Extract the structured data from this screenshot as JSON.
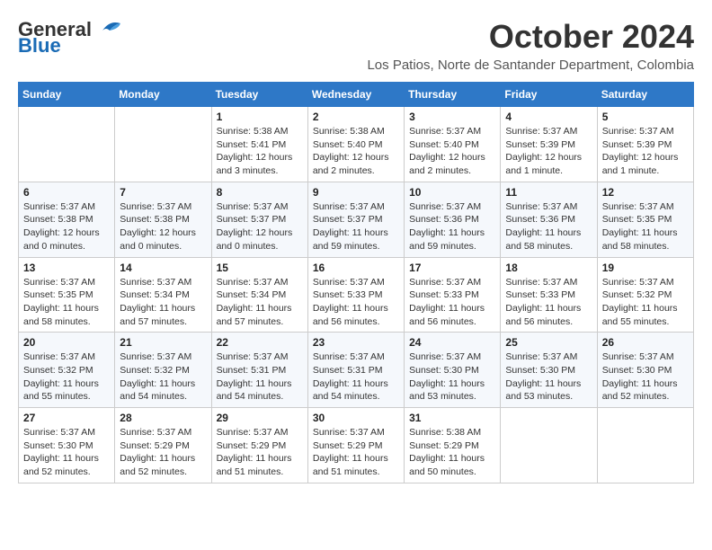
{
  "logo": {
    "general": "General",
    "blue": "Blue"
  },
  "title": "October 2024",
  "location": "Los Patios, Norte de Santander Department, Colombia",
  "weekdays": [
    "Sunday",
    "Monday",
    "Tuesday",
    "Wednesday",
    "Thursday",
    "Friday",
    "Saturday"
  ],
  "weeks": [
    [
      {
        "day": "",
        "info": ""
      },
      {
        "day": "",
        "info": ""
      },
      {
        "day": "1",
        "info": "Sunrise: 5:38 AM\nSunset: 5:41 PM\nDaylight: 12 hours and 3 minutes."
      },
      {
        "day": "2",
        "info": "Sunrise: 5:38 AM\nSunset: 5:40 PM\nDaylight: 12 hours and 2 minutes."
      },
      {
        "day": "3",
        "info": "Sunrise: 5:37 AM\nSunset: 5:40 PM\nDaylight: 12 hours and 2 minutes."
      },
      {
        "day": "4",
        "info": "Sunrise: 5:37 AM\nSunset: 5:39 PM\nDaylight: 12 hours and 1 minute."
      },
      {
        "day": "5",
        "info": "Sunrise: 5:37 AM\nSunset: 5:39 PM\nDaylight: 12 hours and 1 minute."
      }
    ],
    [
      {
        "day": "6",
        "info": "Sunrise: 5:37 AM\nSunset: 5:38 PM\nDaylight: 12 hours and 0 minutes."
      },
      {
        "day": "7",
        "info": "Sunrise: 5:37 AM\nSunset: 5:38 PM\nDaylight: 12 hours and 0 minutes."
      },
      {
        "day": "8",
        "info": "Sunrise: 5:37 AM\nSunset: 5:37 PM\nDaylight: 12 hours and 0 minutes."
      },
      {
        "day": "9",
        "info": "Sunrise: 5:37 AM\nSunset: 5:37 PM\nDaylight: 11 hours and 59 minutes."
      },
      {
        "day": "10",
        "info": "Sunrise: 5:37 AM\nSunset: 5:36 PM\nDaylight: 11 hours and 59 minutes."
      },
      {
        "day": "11",
        "info": "Sunrise: 5:37 AM\nSunset: 5:36 PM\nDaylight: 11 hours and 58 minutes."
      },
      {
        "day": "12",
        "info": "Sunrise: 5:37 AM\nSunset: 5:35 PM\nDaylight: 11 hours and 58 minutes."
      }
    ],
    [
      {
        "day": "13",
        "info": "Sunrise: 5:37 AM\nSunset: 5:35 PM\nDaylight: 11 hours and 58 minutes."
      },
      {
        "day": "14",
        "info": "Sunrise: 5:37 AM\nSunset: 5:34 PM\nDaylight: 11 hours and 57 minutes."
      },
      {
        "day": "15",
        "info": "Sunrise: 5:37 AM\nSunset: 5:34 PM\nDaylight: 11 hours and 57 minutes."
      },
      {
        "day": "16",
        "info": "Sunrise: 5:37 AM\nSunset: 5:33 PM\nDaylight: 11 hours and 56 minutes."
      },
      {
        "day": "17",
        "info": "Sunrise: 5:37 AM\nSunset: 5:33 PM\nDaylight: 11 hours and 56 minutes."
      },
      {
        "day": "18",
        "info": "Sunrise: 5:37 AM\nSunset: 5:33 PM\nDaylight: 11 hours and 56 minutes."
      },
      {
        "day": "19",
        "info": "Sunrise: 5:37 AM\nSunset: 5:32 PM\nDaylight: 11 hours and 55 minutes."
      }
    ],
    [
      {
        "day": "20",
        "info": "Sunrise: 5:37 AM\nSunset: 5:32 PM\nDaylight: 11 hours and 55 minutes."
      },
      {
        "day": "21",
        "info": "Sunrise: 5:37 AM\nSunset: 5:32 PM\nDaylight: 11 hours and 54 minutes."
      },
      {
        "day": "22",
        "info": "Sunrise: 5:37 AM\nSunset: 5:31 PM\nDaylight: 11 hours and 54 minutes."
      },
      {
        "day": "23",
        "info": "Sunrise: 5:37 AM\nSunset: 5:31 PM\nDaylight: 11 hours and 54 minutes."
      },
      {
        "day": "24",
        "info": "Sunrise: 5:37 AM\nSunset: 5:30 PM\nDaylight: 11 hours and 53 minutes."
      },
      {
        "day": "25",
        "info": "Sunrise: 5:37 AM\nSunset: 5:30 PM\nDaylight: 11 hours and 53 minutes."
      },
      {
        "day": "26",
        "info": "Sunrise: 5:37 AM\nSunset: 5:30 PM\nDaylight: 11 hours and 52 minutes."
      }
    ],
    [
      {
        "day": "27",
        "info": "Sunrise: 5:37 AM\nSunset: 5:30 PM\nDaylight: 11 hours and 52 minutes."
      },
      {
        "day": "28",
        "info": "Sunrise: 5:37 AM\nSunset: 5:29 PM\nDaylight: 11 hours and 52 minutes."
      },
      {
        "day": "29",
        "info": "Sunrise: 5:37 AM\nSunset: 5:29 PM\nDaylight: 11 hours and 51 minutes."
      },
      {
        "day": "30",
        "info": "Sunrise: 5:37 AM\nSunset: 5:29 PM\nDaylight: 11 hours and 51 minutes."
      },
      {
        "day": "31",
        "info": "Sunrise: 5:38 AM\nSunset: 5:29 PM\nDaylight: 11 hours and 50 minutes."
      },
      {
        "day": "",
        "info": ""
      },
      {
        "day": "",
        "info": ""
      }
    ]
  ]
}
